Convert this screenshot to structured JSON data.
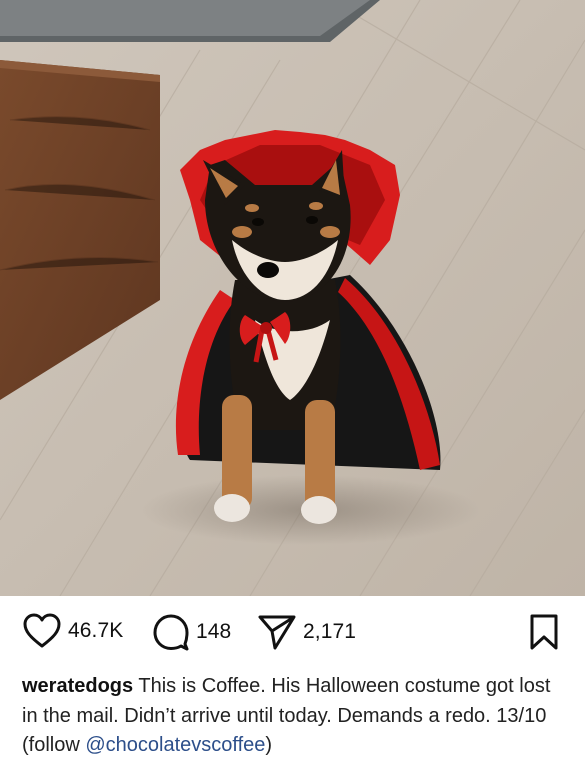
{
  "post": {
    "image": {
      "subject": "dog-photo"
    },
    "actions": {
      "likes": "46.7K",
      "comments": "148",
      "shares": "2,171"
    },
    "caption": {
      "username": "weratedogs",
      "text": "This is Coffee. His Halloween costume got lost in the mail. Didn’t arrive until today. Demands a redo. 13/10 (follow ",
      "mention": "@chocolatevscoffee",
      "closing": ")"
    }
  },
  "icons": {
    "like": "heart-icon",
    "comment": "comment-bubble-icon",
    "share": "send-icon",
    "save": "bookmark-icon"
  },
  "colors": {
    "background": "#ffffff",
    "text": "#111111",
    "mention": "#2d4f8a",
    "cape_red": "#d81d1d",
    "cape_black": "#161616"
  }
}
